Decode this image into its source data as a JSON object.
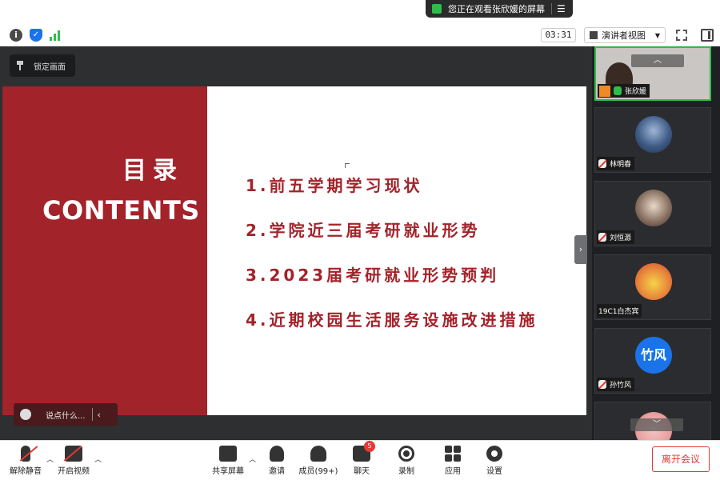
{
  "banner": {
    "text": "您正在观看张欣媛的屏幕",
    "menu_icon": "list-icon"
  },
  "topbar": {
    "timer": "03:31",
    "view_mode": "演讲者视图"
  },
  "stage": {
    "lock_label": "锁定画面",
    "comment_placeholder": "说点什么...",
    "collapse_glyph": "›"
  },
  "slide": {
    "title_cn": "目录",
    "title_en": "CONTENTS",
    "items": [
      "1.前五学期学习现状",
      "2.学院近三届考研就业形势",
      "3.2023届考研就业形势预判",
      "4.近期校园生活服务设施改进措施"
    ],
    "colors": {
      "accent": "#a3232a"
    }
  },
  "participants": [
    {
      "name": "张欣媛",
      "type": "video",
      "mic": "on",
      "host": true
    },
    {
      "name": "林明春",
      "type": "avatar",
      "mic": "off"
    },
    {
      "name": "刘恒源",
      "type": "avatar",
      "mic": "off"
    },
    {
      "name": "19C1白杰宾",
      "type": "avatar",
      "mic": "none"
    },
    {
      "name": "孙竹风",
      "type": "text",
      "mic": "off",
      "avatar_text": "竹风"
    }
  ],
  "toolbar": {
    "mute_label": "解除静音",
    "video_label": "开启视频",
    "share_label": "共享屏幕",
    "invite_label": "邀请",
    "members_label": "成员(99+)",
    "chat_label": "聊天",
    "chat_badge": "5",
    "record_label": "录制",
    "apps_label": "应用",
    "settings_label": "设置",
    "leave_label": "离开会议"
  }
}
